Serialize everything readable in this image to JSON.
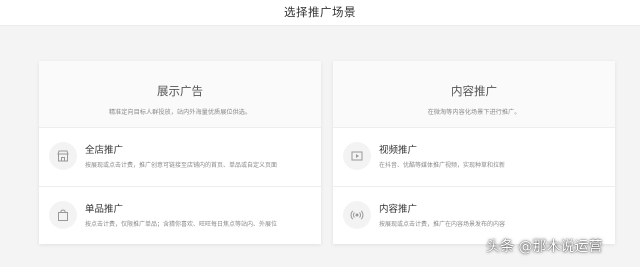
{
  "header": {
    "title": "选择推广场景"
  },
  "left_card": {
    "title": "展示广告",
    "description": "精准定向目标人群投放，站内外海量优质展位供选。",
    "items": [
      {
        "title": "全店推广",
        "description": "按展现或点击计费，推广创意可链接至店铺内的首页、单品或自定义页面",
        "icon": "store-icon"
      },
      {
        "title": "单品推广",
        "description": "按点击计费，仅限推广单品；含猜你喜欢、旺旺每日焦点等站内、外展位",
        "icon": "bag-icon"
      }
    ]
  },
  "right_card": {
    "title": "内容推广",
    "description": "在微淘等内容化场景下进行推广。",
    "items": [
      {
        "title": "视频推广",
        "description": "在抖音、优酷等媒体推广视频，实现种草和拉新",
        "icon": "video-play-icon"
      },
      {
        "title": "内容推广",
        "description": "按展现或点击计费，推广在内容场景发布的内容",
        "icon": "broadcast-icon"
      }
    ]
  },
  "watermark": {
    "text": "头条 @那木说运营"
  }
}
